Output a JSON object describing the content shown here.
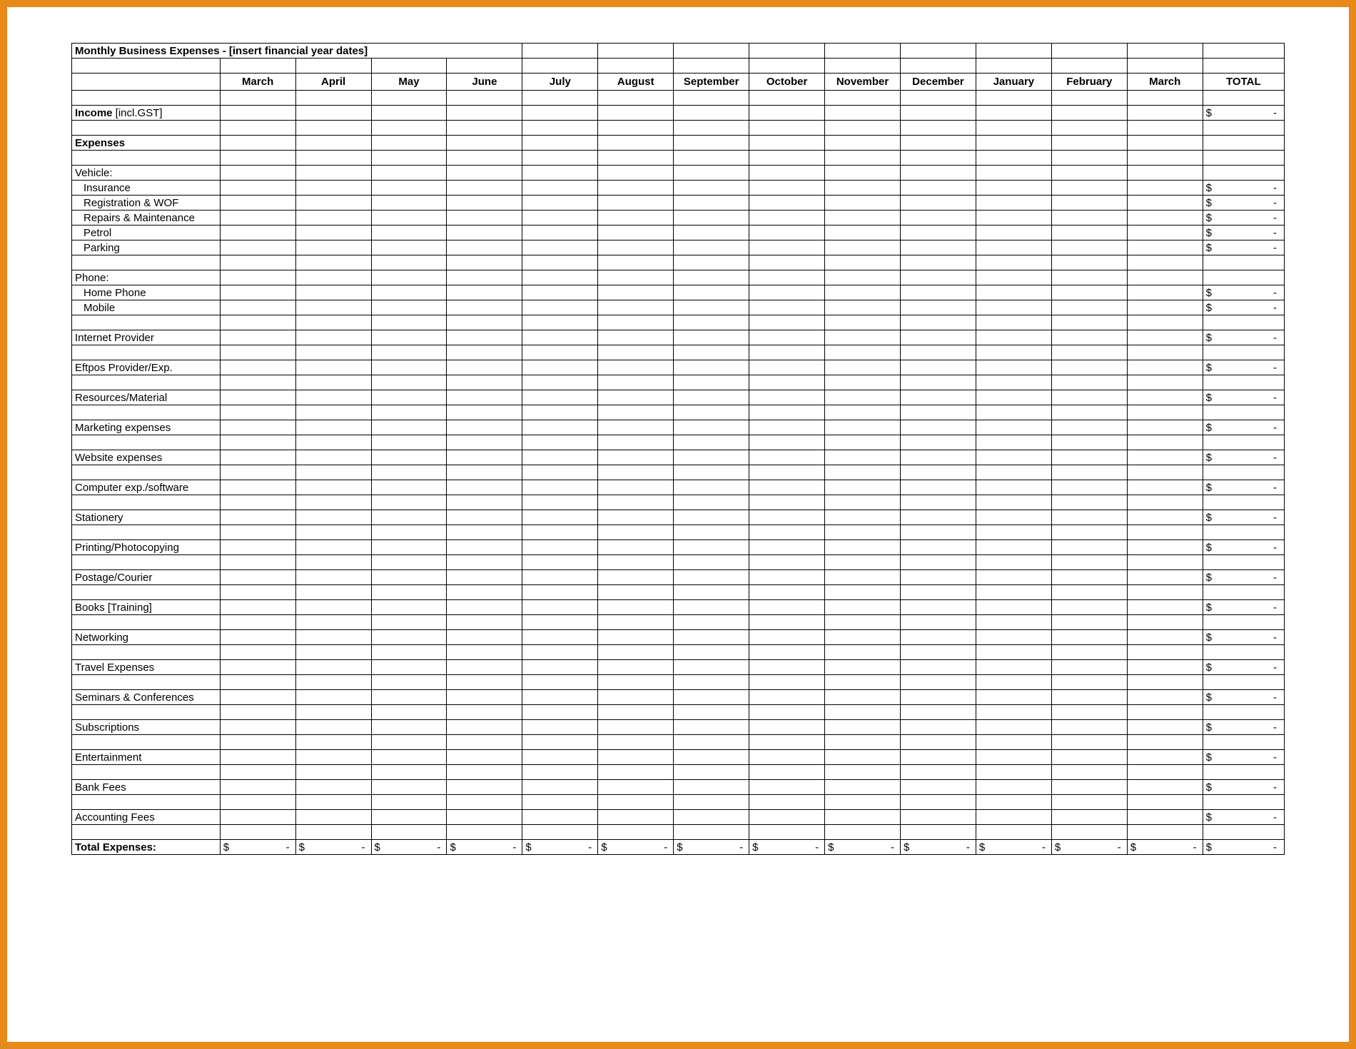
{
  "title": "Monthly Business Expenses - [insert financial year dates]",
  "months": [
    "March",
    "April",
    "May",
    "June",
    "July",
    "August",
    "September",
    "October",
    "November",
    "December",
    "January",
    "February",
    "March"
  ],
  "total_label": "TOTAL",
  "income_label_bold": "Income",
  "income_label_tail": " [incl.GST]",
  "expenses_label": "Expenses",
  "currency": "$",
  "dash": "-",
  "rows": [
    {
      "type": "group",
      "label": "Vehicle:"
    },
    {
      "type": "item",
      "label": "Insurance",
      "indent": true,
      "has_total": true
    },
    {
      "type": "item",
      "label": "Registration & WOF",
      "indent": true,
      "has_total": true
    },
    {
      "type": "item",
      "label": "Repairs & Maintenance",
      "indent": true,
      "has_total": true
    },
    {
      "type": "item",
      "label": "Petrol",
      "indent": true,
      "has_total": true
    },
    {
      "type": "item",
      "label": "Parking",
      "indent": true,
      "has_total": true
    },
    {
      "type": "spacer"
    },
    {
      "type": "group",
      "label": "Phone:"
    },
    {
      "type": "item",
      "label": "Home Phone",
      "indent": true,
      "has_total": true
    },
    {
      "type": "item",
      "label": "Mobile",
      "indent": true,
      "has_total": true
    },
    {
      "type": "spacer"
    },
    {
      "type": "item",
      "label": "Internet Provider",
      "has_total": true
    },
    {
      "type": "spacer"
    },
    {
      "type": "item",
      "label": "Eftpos Provider/Exp.",
      "has_total": true
    },
    {
      "type": "spacer"
    },
    {
      "type": "item",
      "label": "Resources/Material",
      "has_total": true
    },
    {
      "type": "spacer"
    },
    {
      "type": "item",
      "label": "Marketing expenses",
      "has_total": true
    },
    {
      "type": "spacer"
    },
    {
      "type": "item",
      "label": "Website expenses",
      "has_total": true
    },
    {
      "type": "spacer"
    },
    {
      "type": "item",
      "label": "Computer exp./software",
      "has_total": true
    },
    {
      "type": "spacer"
    },
    {
      "type": "item",
      "label": "Stationery",
      "has_total": true
    },
    {
      "type": "spacer"
    },
    {
      "type": "item",
      "label": "Printing/Photocopying",
      "has_total": true
    },
    {
      "type": "spacer"
    },
    {
      "type": "item",
      "label": "Postage/Courier",
      "has_total": true
    },
    {
      "type": "spacer"
    },
    {
      "type": "item",
      "label": "Books [Training]",
      "has_total": true
    },
    {
      "type": "spacer"
    },
    {
      "type": "item",
      "label": "Networking",
      "has_total": true
    },
    {
      "type": "spacer"
    },
    {
      "type": "item",
      "label": "Travel Expenses",
      "has_total": true
    },
    {
      "type": "spacer"
    },
    {
      "type": "item",
      "label": "Seminars & Conferences",
      "has_total": true
    },
    {
      "type": "spacer"
    },
    {
      "type": "item",
      "label": "Subscriptions",
      "has_total": true
    },
    {
      "type": "spacer"
    },
    {
      "type": "item",
      "label": "Entertainment",
      "has_total": true
    },
    {
      "type": "spacer"
    },
    {
      "type": "item",
      "label": "Bank Fees",
      "has_total": true
    },
    {
      "type": "spacer"
    },
    {
      "type": "item",
      "label": "Accounting Fees",
      "has_total": true
    },
    {
      "type": "spacer"
    }
  ],
  "total_expenses_label": "Total Expenses:"
}
